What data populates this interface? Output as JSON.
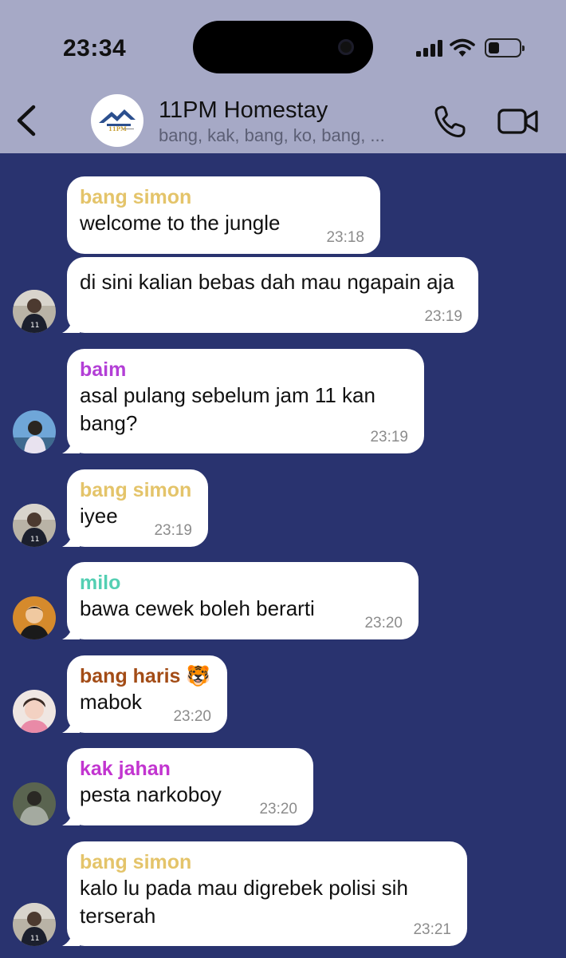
{
  "status_bar": {
    "time": "23:34",
    "battery_level": 0.35
  },
  "header": {
    "title": "11PM Homestay",
    "members": "bang, kak, bang, ko, bang, ...",
    "avatar_icon": "homestay-logo-icon",
    "back_icon": "chevron-left-icon",
    "call_icon": "phone-icon",
    "video_icon": "video-camera-icon"
  },
  "colors": {
    "chat_background": "#29336f",
    "header_background": "#a6a9c6",
    "bang_simon": "#e4c46a",
    "baim": "#b33fd6",
    "milo": "#54cfb3",
    "bang_haris": "#a34c16",
    "kak_jahan": "#c235d0"
  },
  "messages": [
    {
      "sender": "bang simon",
      "text": "welcome to the jungle",
      "time": "23:18"
    },
    {
      "sender": "",
      "text": "di sini kalian bebas dah mau ngapain aja",
      "time": "23:19"
    },
    {
      "sender": "baim",
      "text": "asal pulang sebelum jam 11 kan bang?",
      "time": "23:19"
    },
    {
      "sender": "bang simon",
      "text": "iyee",
      "time": "23:19"
    },
    {
      "sender": "milo",
      "text": "bawa cewek boleh berarti",
      "time": "23:20"
    },
    {
      "sender": "bang haris 🐯",
      "text": "mabok",
      "time": "23:20"
    },
    {
      "sender": "kak jahan",
      "text": "pesta narkoboy",
      "time": "23:20"
    },
    {
      "sender": "bang simon",
      "text": "kalo lu pada mau digrebek polisi sih terserah",
      "time": "23:21"
    }
  ]
}
